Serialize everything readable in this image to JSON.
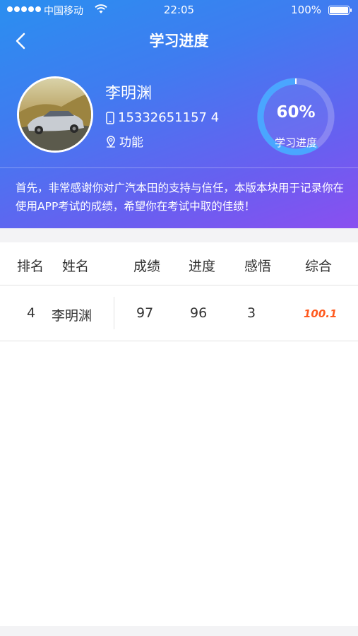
{
  "status_bar": {
    "carrier": "中国移动",
    "time": "22:05",
    "battery": "100%"
  },
  "nav": {
    "title": "学习进度"
  },
  "profile": {
    "name": "李明渊",
    "phone": "15332651157 4",
    "function": "功能"
  },
  "progress": {
    "value_text": "60%",
    "fraction": 0.6,
    "label": "学习进度"
  },
  "notice": "首先，非常感谢你对广汽本田的支持与信任，本版本块用于记录你在使用APP考试的成绩，希望你在考试中取的佳绩！",
  "table": {
    "headers": {
      "rank": "排名",
      "name": "姓名",
      "grade": "成绩",
      "progress": "进度",
      "insight": "感悟",
      "total": "综合"
    },
    "rows": [
      {
        "rank": "4",
        "name": "李明渊",
        "grade": "97",
        "progress": "96",
        "insight": "3",
        "total": "100.1"
      }
    ]
  },
  "colors": {
    "header_gradient_start": "#2a8ff0",
    "header_gradient_end": "#8a4ff0",
    "score_accent": "#ff5a1f"
  }
}
